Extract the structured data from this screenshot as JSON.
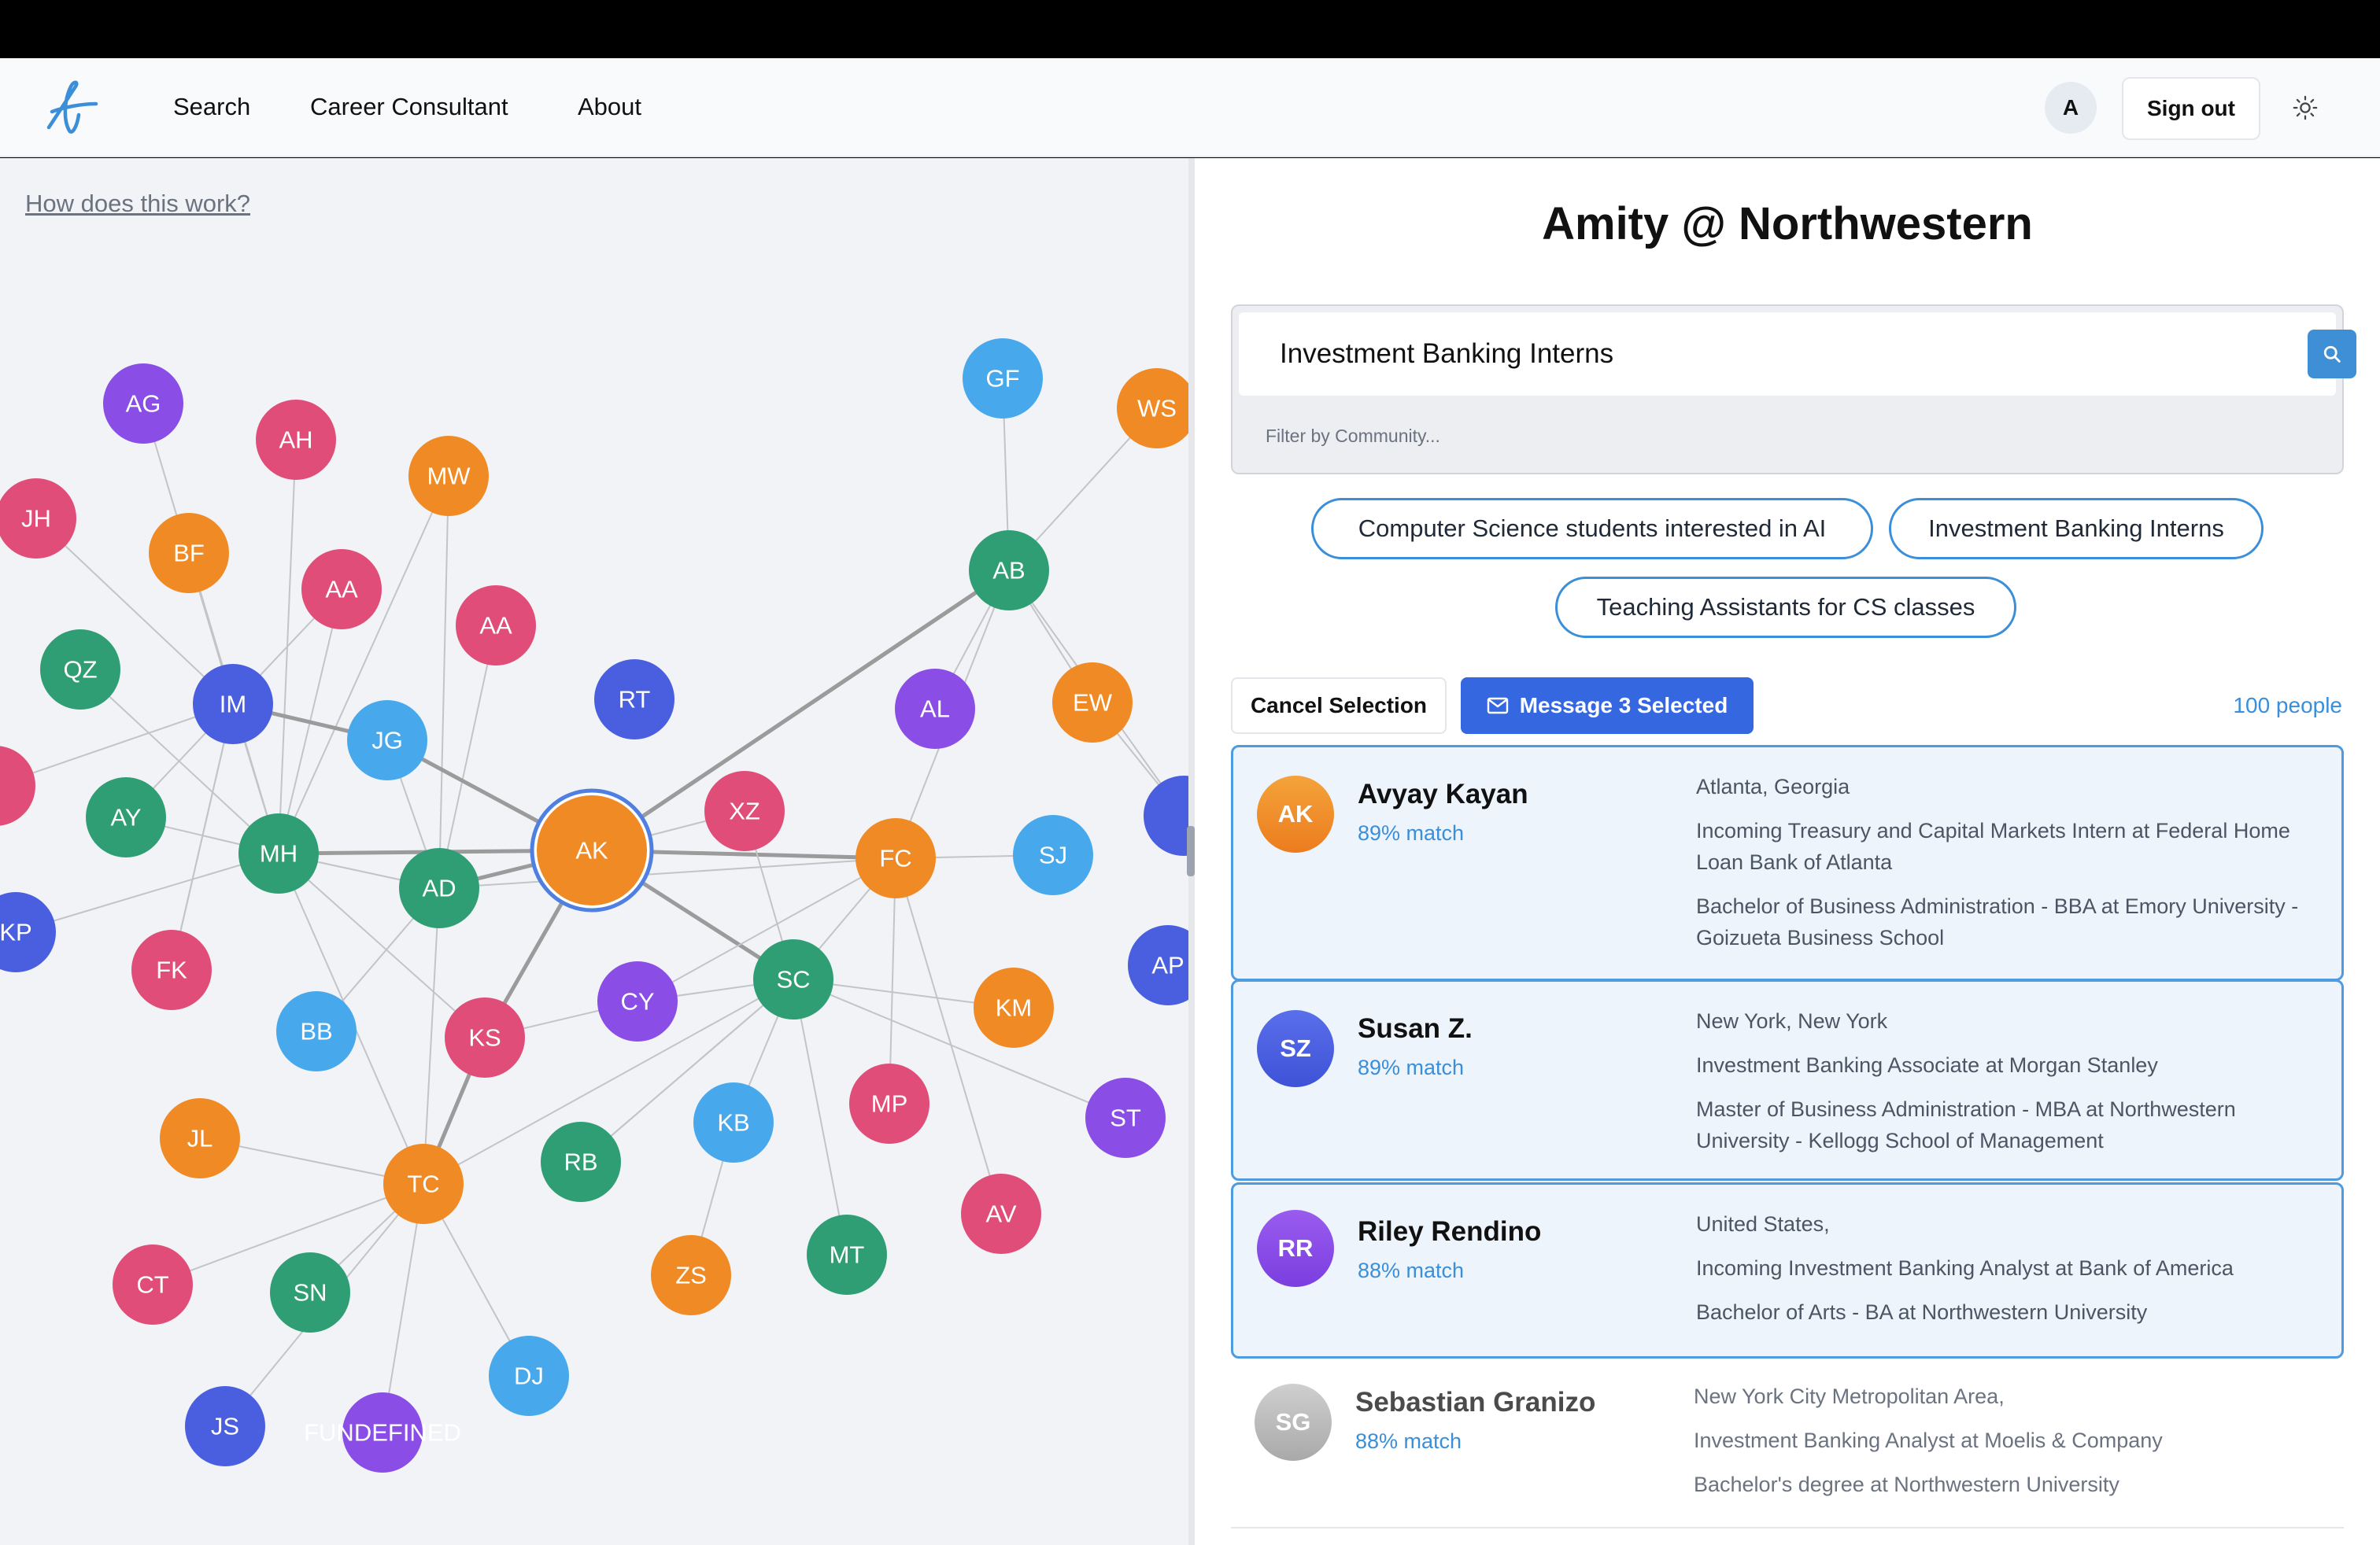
{
  "nav": {
    "links": [
      "Search",
      "Career Consultant",
      "About"
    ],
    "avatar_initial": "A",
    "signout_label": "Sign out"
  },
  "left": {
    "help_link": "How does this work?"
  },
  "graph": {
    "nodes": [
      {
        "label": "AG",
        "color": "#8a4de6"
      },
      {
        "label": "AH",
        "color": "#e04d78"
      },
      {
        "label": "MW",
        "color": "#f08a24"
      },
      {
        "label": "JH",
        "color": "#e04d78"
      },
      {
        "label": "BF",
        "color": "#f08a24"
      },
      {
        "label": "AA",
        "color": "#e04d78"
      },
      {
        "label": "AA",
        "color": "#e04d78"
      },
      {
        "label": "QZ",
        "color": "#2f9e74"
      },
      {
        "label": "IM",
        "color": "#4a5fe0"
      },
      {
        "label": "JG",
        "color": "#48a8ec"
      },
      {
        "label": "RT",
        "color": "#4a5fe0"
      },
      {
        "label": "AY",
        "color": "#2f9e74"
      },
      {
        "label": "MH",
        "color": "#2f9e74"
      },
      {
        "label": "AD",
        "color": "#2f9e74"
      },
      {
        "label": "AK",
        "color": "#f08a24"
      },
      {
        "label": "XZ",
        "color": "#e04d78"
      },
      {
        "label": "FC",
        "color": "#f08a24"
      },
      {
        "label": "SJ",
        "color": "#48a8ec"
      },
      {
        "label": "KP",
        "color": "#4a5fe0"
      },
      {
        "label": "FK",
        "color": "#e04d78"
      },
      {
        "label": "BB",
        "color": "#48a8ec"
      },
      {
        "label": "KS",
        "color": "#e04d78"
      },
      {
        "label": "CY",
        "color": "#8a4de6"
      },
      {
        "label": "SC",
        "color": "#2f9e74"
      },
      {
        "label": "KM",
        "color": "#f08a24"
      },
      {
        "label": "AP",
        "color": "#4a5fe0"
      },
      {
        "label": "JL",
        "color": "#f08a24"
      },
      {
        "label": "TC",
        "color": "#f08a24"
      },
      {
        "label": "RB",
        "color": "#2f9e74"
      },
      {
        "label": "KB",
        "color": "#48a8ec"
      },
      {
        "label": "MP",
        "color": "#e04d78"
      },
      {
        "label": "ST",
        "color": "#8a4de6"
      },
      {
        "label": "CT",
        "color": "#e04d78"
      },
      {
        "label": "SN",
        "color": "#2f9e74"
      },
      {
        "label": "ZS",
        "color": "#f08a24"
      },
      {
        "label": "MT",
        "color": "#2f9e74"
      },
      {
        "label": "AV",
        "color": "#e04d78"
      },
      {
        "label": "DJ",
        "color": "#48a8ec"
      },
      {
        "label": "JS",
        "color": "#4a5fe0"
      },
      {
        "label": "FUNDEFINED",
        "color": "#8a4de6"
      },
      {
        "label": "GF",
        "color": "#48a8ec"
      },
      {
        "label": "WS",
        "color": "#f08a24"
      },
      {
        "label": "AB",
        "color": "#2f9e74"
      },
      {
        "label": "AL",
        "color": "#8a4de6"
      },
      {
        "label": "EW",
        "color": "#f08a24"
      },
      {
        "label": "",
        "color": "#e04d78"
      },
      {
        "label": "",
        "color": "#4a5fe0"
      }
    ]
  },
  "right": {
    "title": "Amity @ Northwestern",
    "search_value": "Investment Banking Interns",
    "filter_placeholder": "Filter by Community...",
    "chips": [
      "Computer Science students interested in AI",
      "Investment Banking Interns",
      "Teaching Assistants for CS classes"
    ],
    "cancel_label": "Cancel Selection",
    "message_label": "Message 3 Selected",
    "people_count": "100 people",
    "results": [
      {
        "initials": "AK",
        "name": "Avyay Kayan",
        "match": "89% match",
        "location": "Atlanta, Georgia",
        "role": "Incoming Treasury and Capital Markets Intern at Federal Home Loan Bank of Atlanta",
        "education": "Bachelor of Business Administration - BBA at Emory University - Goizueta Business School",
        "color": "#f08a24",
        "selected": true
      },
      {
        "initials": "SZ",
        "name": "Susan Z.",
        "match": "89% match",
        "location": "New York, New York",
        "role": "Investment Banking Associate at Morgan Stanley",
        "education": "Master of Business Administration - MBA at Northwestern University - Kellogg School of Management",
        "color": "#4a5fe0",
        "selected": true
      },
      {
        "initials": "RR",
        "name": "Riley Rendino",
        "match": "88% match",
        "location": "United States,",
        "role": "Incoming Investment Banking Analyst at Bank of America",
        "education": "Bachelor of Arts - BA at Northwestern University",
        "color": "#8a4de6",
        "selected": true
      },
      {
        "initials": "SG",
        "name": "Sebastian Granizo",
        "match": "88% match",
        "location": "New York City Metropolitan Area,",
        "role": "Investment Banking Analyst at Moelis & Company",
        "education": "Bachelor's degree at Northwestern University",
        "color": "#bdbdbd",
        "selected": false
      }
    ]
  }
}
